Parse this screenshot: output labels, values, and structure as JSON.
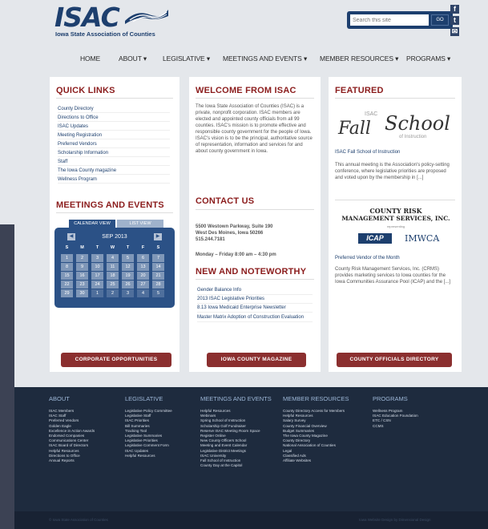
{
  "header": {
    "logo_text": "ISAC",
    "logo_tagline": "Iowa State Association of Counties",
    "search_placeholder": "Search this site",
    "search_button": "GO",
    "social": [
      "f",
      "t",
      "✉"
    ]
  },
  "nav": [
    "HOME",
    "ABOUT ▾",
    "LEGISLATIVE ▾",
    "MEETINGS AND EVENTS ▾",
    "MEMBER RESOURCES ▾",
    "PROGRAMS ▾"
  ],
  "quick_links": {
    "title": "QUICK LINKS",
    "items": [
      "County Directory",
      "Directions to Office",
      "ISAC Updates",
      "Meeting Registration",
      "Preferred Vendors",
      "Scholarship Information",
      "Staff",
      "The Iowa County magazine",
      "Wellness Program"
    ]
  },
  "meetings": {
    "title": "MEETINGS AND EVENTS",
    "tabs": [
      "CALENDAR VIEW",
      "LIST VIEW"
    ],
    "month": "SEP 2013",
    "weekdays": [
      "S",
      "M",
      "T",
      "W",
      "T",
      "F",
      "S"
    ],
    "weeks": [
      [
        "1",
        "2",
        "3",
        "4",
        "5",
        "6",
        "7"
      ],
      [
        "8",
        "9",
        "10",
        "11",
        "12",
        "13",
        "14"
      ],
      [
        "15",
        "16",
        "17",
        "18",
        "19",
        "20",
        "21"
      ],
      [
        "22",
        "23",
        "24",
        "25",
        "26",
        "27",
        "28"
      ],
      [
        "29",
        "30",
        "1",
        "2",
        "3",
        "4",
        "5"
      ]
    ]
  },
  "corporate_button": "CORPORATE OPPORTUNITIES",
  "welcome": {
    "title": "WELCOME FROM ISAC",
    "body": "The Iowa State Association of Counties (ISAC) is a private, nonprofit corporation. ISAC members are elected and appointed county officials from all 99 counties. ISAC's mission is to promote effective and responsible county government for the people of Iowa. ISAC's vision is to be the principal, authoritative source of representation, information and services for and about county government in Iowa."
  },
  "contact": {
    "title": "CONTACT US",
    "address1": "5500 Westown Parkway, Suite 190",
    "address2": "West Des Moines, Iowa 50266",
    "phone": "515.244.7181",
    "hours": "Monday – Friday 8:00 am – 4:30 pm"
  },
  "news": {
    "title": "NEW AND NOTEWORTHY",
    "items": [
      "Gender Balance Info",
      "2013 ISAC Legislative Priorities",
      "8.13 Iowa Medicaid Enterprise Newsletter",
      "Master Matrix Adoption of Construction Evaluation"
    ]
  },
  "magazine_button": "IOWA COUNTY MAGAZINE",
  "featured": {
    "title": "FEATURED",
    "fall_isac": "ISAC",
    "fall_word": "Fall",
    "school_word": "School",
    "of_instruction": "of Instruction",
    "fall_caption": "ISAC Fall School of Instruction",
    "fall_body": "This annual meeting is the Association's policy-setting conference, where legislative priorities are proposed and voted upon by the membership in [...]",
    "crms_line1": "COUNTY RISK",
    "crms_line2": "MANAGEMENT SERVICES, INC.",
    "crms_rep": "representing",
    "icap": "ICAP",
    "imwca": "IMWCA",
    "vendor_caption": "Preferred Vendor of the Month",
    "vendor_body": "County Risk Management Services, Inc. (CRMS) provides marketing services to Iowa counties for the Iowa Communities Assurance Pool (ICAP) and the [...]"
  },
  "directory_button": "COUNTY OFFICIALS DIRECTORY",
  "footer": {
    "columns": [
      {
        "title": "ABOUT",
        "links": [
          "ISAC Members",
          "ISAC Staff",
          "Preferred Vendors",
          "Golden Eagle",
          "Excellence in Action Awards",
          "Endorsed Companies",
          "Communications Center",
          "ISAC Board of Directors",
          "Helpful Resources",
          "Directions to Office",
          "Annual Reports"
        ]
      },
      {
        "title": "LEGISLATIVE",
        "links": [
          "Legislative Policy Committee",
          "Legislative Staff",
          "ISAC Priorities",
          "Bill Summaries",
          "Tracking Tool",
          "Legislative Summaries",
          "Legislative Priorities",
          "Legislative Comment Form",
          "ISAC Updates",
          "Helpful Resources"
        ]
      },
      {
        "title": "MEETINGS AND EVENTS",
        "links": [
          "Helpful Resources",
          "Webinars",
          "Spring School of Instruction",
          "Scholarship Golf Fundraiser",
          "Reserve ISAC Meeting Room Space",
          "Register Online",
          "New County Officers School",
          "Meeting and Event Calendar",
          "Legislative District Meetings",
          "ISAC University",
          "Fall School of Instruction",
          "County Day at the Capitol"
        ]
      },
      {
        "title": "MEMBER RESOURCES",
        "links": [
          "County Directory Access for Members",
          "Helpful Resources",
          "Salary Survey",
          "County Financial Overview",
          "Budget Summaries",
          "The Iowa County Magazine",
          "County Directory",
          "National Association of Counties",
          "Legal",
          "Classified Ads",
          "Affiliate Websites"
        ]
      },
      {
        "title": "PROGRAMS",
        "links": [
          "Wellness Program",
          "ISAC Education Foundation",
          "ETC / CSN",
          "CCMS"
        ]
      }
    ],
    "copyright": "© Iowa State Association of Counties",
    "credit": "Iowa Website Design by Dimensional Design"
  },
  "colors": {
    "brand_navy": "#1d3f6e",
    "heading_red": "#8b1c1c",
    "button_red": "#8b2f2f",
    "calendar_blue": "#2b5186",
    "footer_bg": "#1e2b3e"
  }
}
